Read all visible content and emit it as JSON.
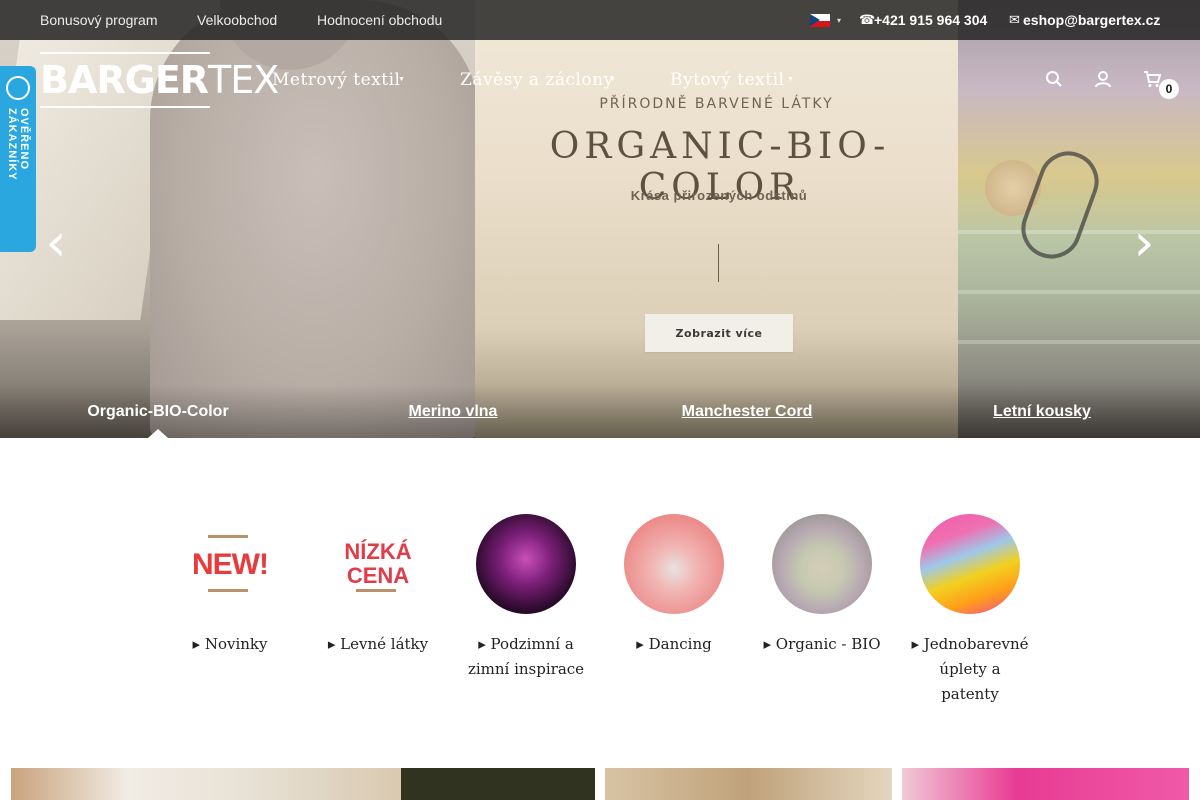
{
  "topbar": {
    "links": [
      "Bonusový program",
      "Velkoobchod",
      "Hodnocení obchodu"
    ],
    "language_flag": "flag-cz-icon",
    "phone": "+421 915 964 304",
    "email": "eshop@bargertex.cz"
  },
  "header": {
    "logo_bold": "BARGER",
    "logo_thin": "TEX",
    "nav": [
      "Metrový textil",
      "Závěsy a záclony",
      "Bytový textil"
    ],
    "cart_count": "0"
  },
  "verified_badge": {
    "text": "OVĚŘENO ZÁKAZNÍKY"
  },
  "hero": {
    "subtitle": "PŘÍRODNĚ BARVENÉ LÁTKY",
    "title": "ORGANIC-BIO-COLOR",
    "description": "Krása přirozených odstínů",
    "cta": "Zobrazit více",
    "tabs": [
      "Organic-BIO-Color",
      "Merino vlna",
      "Manchester Cord",
      "Letní kousky"
    ],
    "active_tab": 0
  },
  "categories": [
    {
      "label": "Novinky",
      "image_text": "NEW!"
    },
    {
      "label": "Levné látky",
      "image_text": "NÍZKÁ CENA"
    },
    {
      "label": "Podzimní a zimní inspirace"
    },
    {
      "label": "Dancing"
    },
    {
      "label": "Organic - BIO"
    },
    {
      "label": "Jednobarevné úplety a patenty"
    }
  ],
  "colors": {
    "topbar_bg": "#1e1e1e",
    "verified_bg": "#2ba7e0",
    "new_red": "#e83c3c"
  }
}
